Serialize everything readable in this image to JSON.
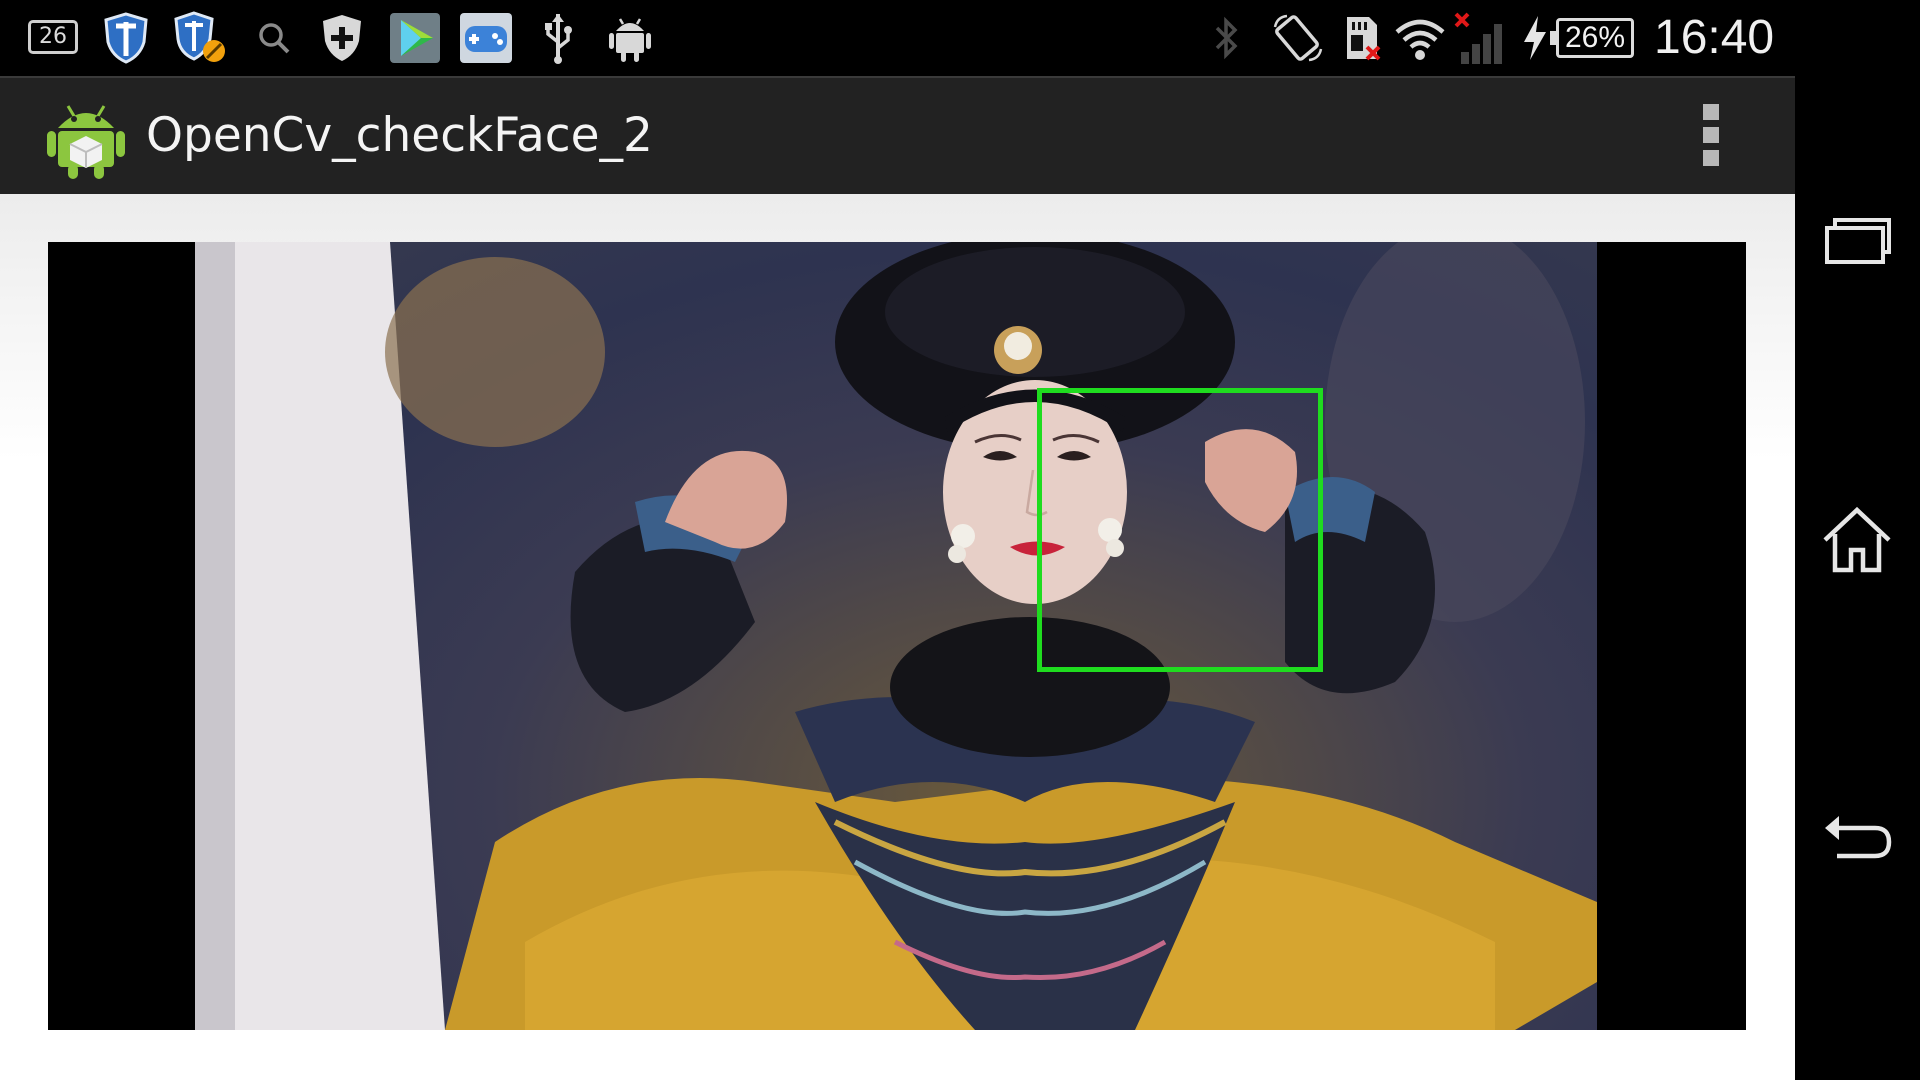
{
  "status_bar": {
    "notification_count": "26",
    "battery_percent": "26%",
    "time": "16:40",
    "left_icons": [
      "notification-count-icon",
      "shield-icon",
      "shield-blocked-icon",
      "search-icon",
      "shield-plus-icon",
      "play-store-icon",
      "gamepad-icon",
      "usb-icon",
      "android-icon"
    ],
    "right_icons": [
      "bluetooth-icon",
      "rotation-icon",
      "sd-card-error-icon",
      "wifi-icon",
      "signal-no-service-icon",
      "charging-icon",
      "battery-icon"
    ]
  },
  "action_bar": {
    "title": "OpenCv_checkFace_2",
    "menu_icon": "overflow-menu-icon"
  },
  "camera": {
    "detection_color": "#1fdc1f",
    "detected_faces": 1
  },
  "nav_bar": {
    "buttons": [
      "recent-apps-icon",
      "home-icon",
      "back-icon"
    ]
  },
  "colors": {
    "action_bar_bg": "#222222",
    "status_bar_bg": "#000000",
    "battery_border": "#dcdcdc"
  }
}
